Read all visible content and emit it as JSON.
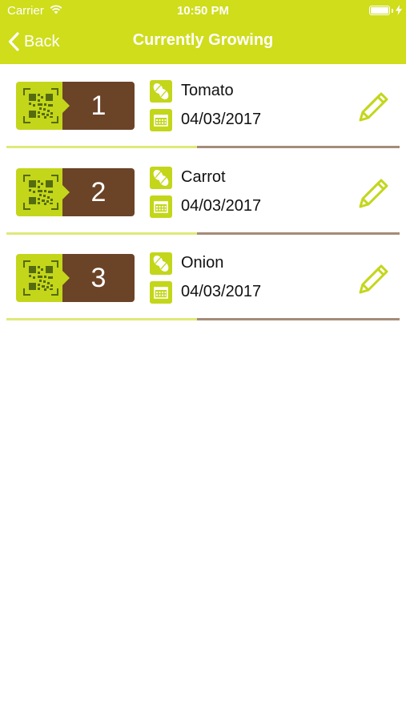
{
  "status_bar": {
    "carrier": "Carrier",
    "time": "10:50 PM"
  },
  "nav": {
    "back_label": "Back",
    "title": "Currently Growing"
  },
  "colors": {
    "accent": "#cfdd1b",
    "brown": "#6b4327"
  },
  "items": [
    {
      "number": "1",
      "plant": "Tomato",
      "date": "04/03/2017"
    },
    {
      "number": "2",
      "plant": "Carrot",
      "date": "04/03/2017"
    },
    {
      "number": "3",
      "plant": "Onion",
      "date": "04/03/2017"
    }
  ]
}
